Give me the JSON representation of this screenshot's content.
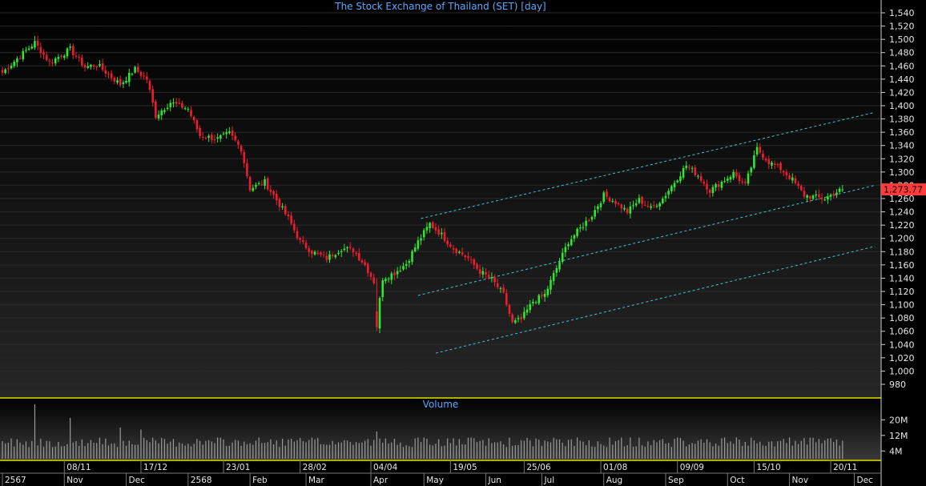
{
  "chart_data": {
    "type": "candlestick",
    "title": "The Stock Exchange of Thailand (SET) [day]",
    "price_axis": {
      "ylim": [
        960,
        1550
      ],
      "ticks": [
        1540,
        1520,
        1500,
        1480,
        1460,
        1440,
        1420,
        1400,
        1380,
        1360,
        1340,
        1320,
        1300,
        1280,
        1260,
        1240,
        1220,
        1200,
        1180,
        1160,
        1140,
        1120,
        1100,
        1080,
        1060,
        1040,
        1020,
        1000,
        980
      ],
      "tick_labels": [
        "1,540",
        "1,520",
        "1,500",
        "1,480",
        "1,460",
        "1,440",
        "1,420",
        "1,400",
        "1,380",
        "1,360",
        "1,340",
        "1,320",
        "1,300",
        "1,280",
        "1,260",
        "1,240",
        "1,220",
        "1,200",
        "1,180",
        "1,160",
        "1,140",
        "1,120",
        "1,100",
        "1,080",
        "1,060",
        "1,040",
        "1,020",
        "1,000",
        "980"
      ]
    },
    "last_price": 1273.77,
    "last_price_label": "1,273.77",
    "volume_panel": {
      "title": "Volume",
      "ylim": [
        0,
        30
      ],
      "ticks": [
        20,
        12,
        4
      ],
      "tick_labels": [
        "20M",
        "12M",
        "4M"
      ],
      "unit": "M"
    },
    "date_axis": {
      "weeks": [
        {
          "label": "08/11",
          "index": 21
        },
        {
          "label": "17/12",
          "index": 47
        },
        {
          "label": "23/01",
          "index": 75
        },
        {
          "label": "28/02",
          "index": 101
        },
        {
          "label": "04/04",
          "index": 125
        },
        {
          "label": "19/05",
          "index": 152
        },
        {
          "label": "25/06",
          "index": 177
        },
        {
          "label": "01/08",
          "index": 203
        },
        {
          "label": "09/09",
          "index": 229
        },
        {
          "label": "15/10",
          "index": 255
        },
        {
          "label": "20/11",
          "index": 281
        }
      ],
      "months": [
        {
          "label": "2567",
          "index": 0
        },
        {
          "label": "Nov",
          "index": 21
        },
        {
          "label": "Dec",
          "index": 42
        },
        {
          "label": "2568",
          "index": 63
        },
        {
          "label": "Feb",
          "index": 84
        },
        {
          "label": "Mar",
          "index": 103
        },
        {
          "label": "Apr",
          "index": 125
        },
        {
          "label": "May",
          "index": 143
        },
        {
          "label": "Jun",
          "index": 164
        },
        {
          "label": "Jul",
          "index": 183
        },
        {
          "label": "Aug",
          "index": 204
        },
        {
          "label": "Sep",
          "index": 225
        },
        {
          "label": "Oct",
          "index": 246
        },
        {
          "label": "Nov",
          "index": 267
        },
        {
          "label": "Dec",
          "index": 289
        }
      ]
    },
    "anchors": [
      [
        0,
        1450
      ],
      [
        6,
        1475
      ],
      [
        11,
        1495
      ],
      [
        16,
        1465
      ],
      [
        23,
        1485
      ],
      [
        28,
        1458
      ],
      [
        32,
        1462
      ],
      [
        40,
        1432
      ],
      [
        45,
        1455
      ],
      [
        49,
        1440
      ],
      [
        52,
        1385
      ],
      [
        57,
        1405
      ],
      [
        63,
        1395
      ],
      [
        67,
        1355
      ],
      [
        73,
        1350
      ],
      [
        77,
        1358
      ],
      [
        81,
        1335
      ],
      [
        84,
        1275
      ],
      [
        89,
        1285
      ],
      [
        93,
        1258
      ],
      [
        97,
        1230
      ],
      [
        101,
        1195
      ],
      [
        105,
        1180
      ],
      [
        110,
        1170
      ],
      [
        115,
        1185
      ],
      [
        119,
        1182
      ],
      [
        123,
        1160
      ],
      [
        126,
        1135
      ],
      [
        127,
        1075
      ],
      [
        129,
        1140
      ],
      [
        133,
        1148
      ],
      [
        137,
        1162
      ],
      [
        141,
        1195
      ],
      [
        145,
        1222
      ],
      [
        149,
        1205
      ],
      [
        153,
        1185
      ],
      [
        158,
        1170
      ],
      [
        162,
        1150
      ],
      [
        166,
        1138
      ],
      [
        170,
        1115
      ],
      [
        173,
        1072
      ],
      [
        176,
        1078
      ],
      [
        180,
        1105
      ],
      [
        184,
        1115
      ],
      [
        188,
        1155
      ],
      [
        192,
        1195
      ],
      [
        196,
        1215
      ],
      [
        200,
        1235
      ],
      [
        204,
        1265
      ],
      [
        208,
        1255
      ],
      [
        212,
        1240
      ],
      [
        216,
        1258
      ],
      [
        220,
        1245
      ],
      [
        224,
        1260
      ],
      [
        228,
        1285
      ],
      [
        232,
        1310
      ],
      [
        236,
        1295
      ],
      [
        240,
        1272
      ],
      [
        244,
        1285
      ],
      [
        248,
        1298
      ],
      [
        252,
        1280
      ],
      [
        256,
        1335
      ],
      [
        260,
        1315
      ],
      [
        264,
        1305
      ],
      [
        268,
        1288
      ],
      [
        272,
        1265
      ],
      [
        276,
        1262
      ],
      [
        279,
        1260
      ],
      [
        282,
        1268
      ],
      [
        285,
        1273.77
      ]
    ],
    "extremes": {
      "high": 1505,
      "high_index": 11,
      "low": 1060,
      "low_index": 127
    },
    "trend_lines": [
      {
        "from": [
          142,
          1230
        ],
        "to": [
          296,
          1390
        ]
      },
      {
        "from": [
          141,
          1114
        ],
        "to": [
          296,
          1280
        ]
      },
      {
        "from": [
          147,
          1027
        ],
        "to": [
          296,
          1188
        ]
      }
    ],
    "bar_count": 286,
    "colors": {
      "background": "#000000",
      "up": "#2ee82e",
      "down": "#ee1c2e",
      "grid": "#2a2a2a",
      "axis_text": "#e6e6e6",
      "title": "#5aa8ff",
      "trend": "#39c9d9",
      "separator": "#e8e800",
      "volume": "#9a9a9a",
      "last_price_bg": "#ff3b3b"
    }
  }
}
